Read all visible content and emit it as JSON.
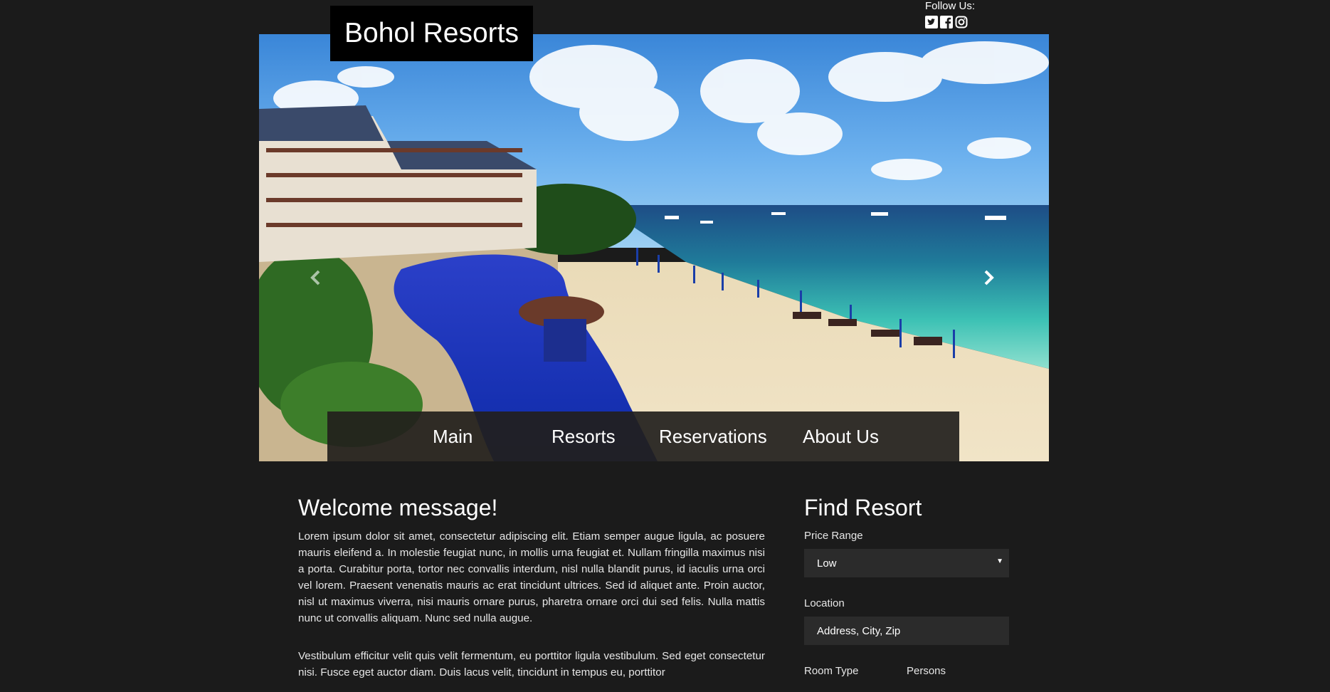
{
  "header": {
    "logo_text": "Bohol Resorts",
    "follow_label": "Follow Us:",
    "social_icons": [
      "twitter-icon",
      "facebook-icon",
      "instagram-icon"
    ]
  },
  "hero": {
    "prev_icon": "chevron-left-icon",
    "next_icon": "chevron-right-icon"
  },
  "nav": {
    "items": [
      {
        "label": "Main"
      },
      {
        "label": "Resorts"
      },
      {
        "label": "Reservations"
      },
      {
        "label": "About Us"
      }
    ]
  },
  "welcome": {
    "title": "Welcome message!",
    "paragraphs": [
      "Lorem ipsum dolor sit amet, consectetur adipiscing elit. Etiam semper augue ligula, ac posuere mauris eleifend a. In molestie feugiat nunc, in mollis urna feugiat et. Nullam fringilla maximus nisi a porta. Curabitur porta, tortor nec convallis interdum, nisl nulla blandit purus, id iaculis urna orci vel lorem. Praesent venenatis mauris ac erat tincidunt ultrices. Sed id aliquet ante. Proin auctor, nisl ut maximus viverra, nisi mauris ornare purus, pharetra ornare orci dui sed felis. Nulla mattis nunc ut convallis aliquam. Nunc sed nulla augue.",
      "Vestibulum efficitur velit quis velit fermentum, eu porttitor ligula vestibulum. Sed eget consectetur nisi. Fusce eget auctor diam. Duis lacus velit, tincidunt in tempus eu, porttitor"
    ]
  },
  "find": {
    "title": "Find Resort",
    "price_label": "Price Range",
    "price_value": "Low",
    "location_label": "Location",
    "location_placeholder": "Address, City, Zip",
    "room_type_label": "Room Type",
    "persons_label": "Persons"
  },
  "colors": {
    "background": "#1b1b1b",
    "field_background": "#2b2b2b",
    "logo_background": "#000000",
    "nav_background": "#22201c"
  }
}
